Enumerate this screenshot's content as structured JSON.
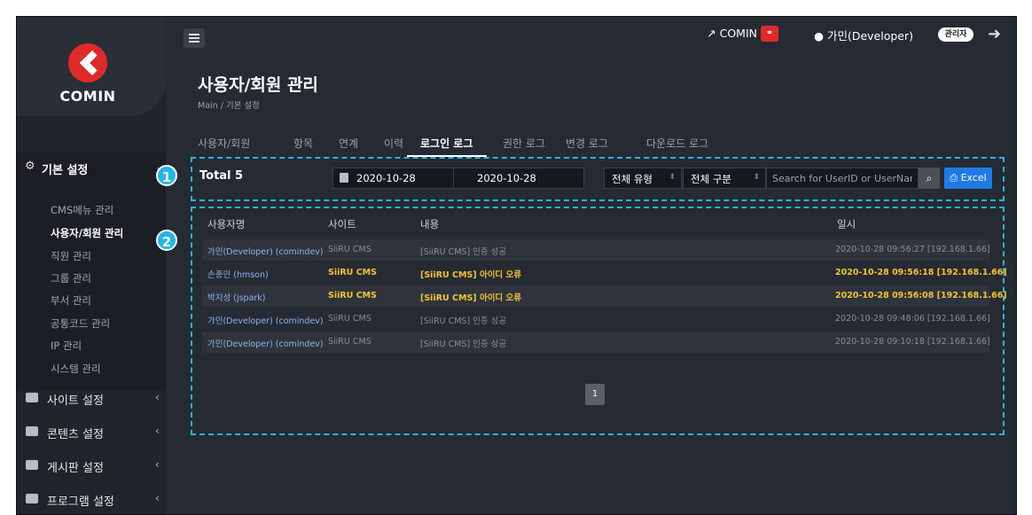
{
  "brand": {
    "name": "COMIN"
  },
  "header": {
    "comin_link": "COMIN",
    "user_name": "가민(Developer)",
    "admin_badge": "관리자"
  },
  "page": {
    "title": "사용자/회원 관리",
    "breadcrumb": "Main / 기본 설정"
  },
  "sidebar": {
    "basic": {
      "label": "기본 설정",
      "items": [
        "CMS메뉴 관리",
        "사용자/회원 관리",
        "직원 관리",
        "그룹 관리",
        "부서 관리",
        "공통코드 관리",
        "IP 관리",
        "시스템 관리"
      ],
      "active_index": 1
    },
    "sections": [
      "사이트 설정",
      "콘텐츠 설정",
      "게시판 설정",
      "프로그램 설정"
    ]
  },
  "tabs": [
    "사용자/회원",
    "항목",
    "연계",
    "이력",
    "로그인 로그",
    "권한 로그",
    "변경 로그",
    "다운로드 로그"
  ],
  "active_tab": "로그인 로그",
  "filter": {
    "total": "Total 5",
    "date_from": "2020-10-28",
    "date_sep": "~",
    "date_to": "2020-10-28",
    "type_select": "전체 유형",
    "category_select": "전체 구분",
    "search_placeholder": "Search for UserID or UserName",
    "excel_label": "Excel"
  },
  "table": {
    "headers": [
      "사용자명",
      "사이트",
      "내용",
      "일시"
    ],
    "rows": [
      {
        "user": "가민(Developer) (comindev)",
        "site": "SiiRU CMS",
        "content": "[SiiRU CMS] 인증 성공",
        "date": "2020-10-28 09:56:27 [192.168.1.66]",
        "error": false
      },
      {
        "user": "손종민 (hmson)",
        "site": "SiiRU CMS",
        "content": "[SiiRU CMS] 아이디 오류",
        "date": "2020-10-28 09:56:18 [192.168.1.66]",
        "error": true
      },
      {
        "user": "박지성 (jspark)",
        "site": "SiiRU CMS",
        "content": "[SiiRU CMS] 아이디 오류",
        "date": "2020-10-28 09:56:08 [192.168.1.66]",
        "error": true
      },
      {
        "user": "가민(Developer) (comindev)",
        "site": "SiiRU CMS",
        "content": "[SiiRU CMS] 인증 성공",
        "date": "2020-10-28 09:48:06 [192.168.1.66]",
        "error": false
      },
      {
        "user": "가민(Developer) (comindev)",
        "site": "SiiRU CMS",
        "content": "[SiiRU CMS] 인증 성공",
        "date": "2020-10-28 09:10:18 [192.168.1.66]",
        "error": false
      }
    ]
  },
  "pagination": {
    "current": "1"
  },
  "markers": [
    "1",
    "2"
  ],
  "colors": {
    "accent_blue": "#1e7be6",
    "callout": "#22b6e8",
    "error": "#f3c234",
    "brand_red": "#e02a2a"
  }
}
